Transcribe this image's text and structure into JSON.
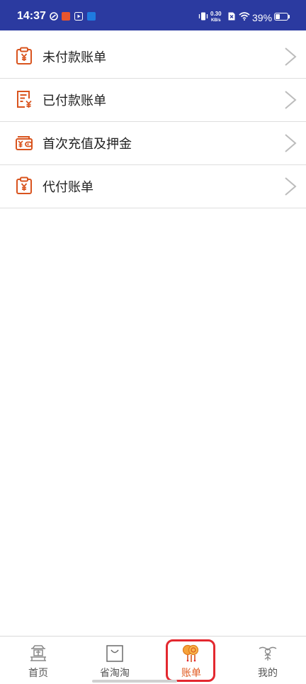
{
  "status_bar": {
    "time": "14:37",
    "net_speed_value": "0.30",
    "net_speed_unit": "KB/s",
    "battery": "39%",
    "battery_level": 0.39,
    "background_color": "#2b3aa0"
  },
  "menu": {
    "items": [
      {
        "label": "未付款账单",
        "icon": "unpaid-bill-icon"
      },
      {
        "label": "已付款账单",
        "icon": "paid-bill-icon"
      },
      {
        "label": "首次充值及押金",
        "icon": "wallet-icon"
      },
      {
        "label": "代付账单",
        "icon": "proxy-pay-bill-icon"
      }
    ],
    "accent_color": "#d9541e"
  },
  "tabbar": {
    "tabs": [
      {
        "label": "首页",
        "icon": "home-icon",
        "active": false
      },
      {
        "label": "省淘淘",
        "icon": "shopping-bag-icon",
        "active": false
      },
      {
        "label": "账单",
        "icon": "bill-coins-icon",
        "active": true
      },
      {
        "label": "我的",
        "icon": "profile-icon",
        "active": false
      }
    ],
    "active_color": "#e05a20",
    "highlight_color": "#e3282f"
  }
}
